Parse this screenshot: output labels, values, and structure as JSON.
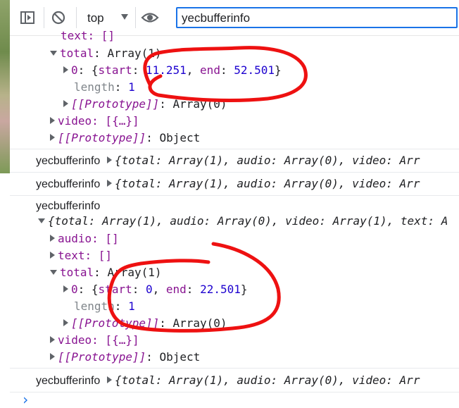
{
  "toolbar": {
    "context": "top",
    "filter_value": "yecbufferinfo"
  },
  "console": {
    "log_label": "yecbufferinfo",
    "top_entry": {
      "text_line": "text: []",
      "total_key": "total",
      "total_val": "Array(1)",
      "item0": {
        "index": "0",
        "start_key": "start",
        "start": "11.251",
        "end_key": "end",
        "end": "52.501"
      },
      "length_key": "length",
      "length": "1",
      "proto_key": "[[Prototype]]",
      "proto_array": "Array(0)",
      "video": "video: [{…}]",
      "proto_object": "Object"
    },
    "collapsed_summary": "{total: Array(1), audio: Array(0), video: Arr",
    "expanded_summary": "{total: Array(1), audio: Array(0), video: Array(1), text: A",
    "expanded_entry": {
      "audio": "audio: []",
      "text_line": "text: []",
      "total_key": "total",
      "total_val": "Array(1)",
      "item0": {
        "index": "0",
        "start_key": "start",
        "start": "0",
        "end_key": "end",
        "end": "22.501"
      },
      "length_key": "length",
      "length": "1",
      "proto_key": "[[Prototype]]",
      "proto_array": "Array(0)",
      "video": "video: [{…}]",
      "proto_object": "Object"
    },
    "prompt_glyph": "›"
  },
  "annotation_color": "#ee1111"
}
